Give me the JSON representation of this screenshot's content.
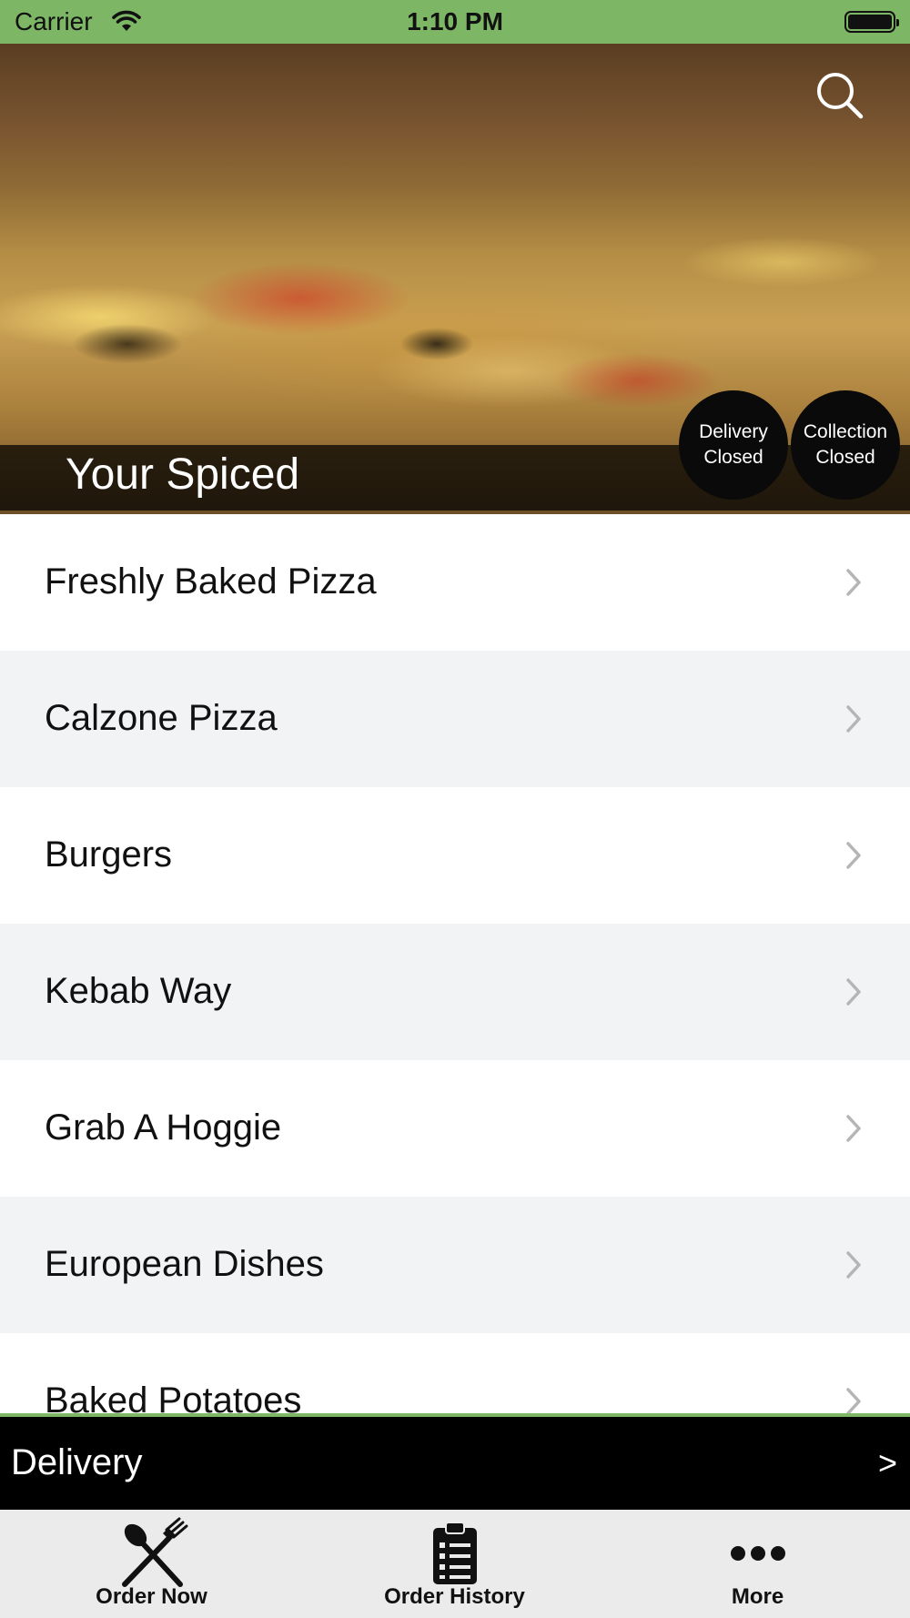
{
  "status_bar": {
    "carrier": "Carrier",
    "time": "1:10 PM",
    "wifi_icon": "wifi-icon",
    "battery_icon": "battery-icon"
  },
  "hero": {
    "title": "Your Spiced",
    "search_icon": "search-icon",
    "badges": {
      "delivery": {
        "line1": "Delivery",
        "line2": "Closed"
      },
      "collection": {
        "line1": "Collection",
        "line2": "Closed"
      }
    }
  },
  "menu": {
    "items": [
      {
        "label": "Freshly Baked Pizza"
      },
      {
        "label": "Calzone Pizza"
      },
      {
        "label": "Burgers"
      },
      {
        "label": "Kebab Way"
      },
      {
        "label": "Grab A Hoggie"
      },
      {
        "label": "European Dishes"
      },
      {
        "label": "Baked Potatoes"
      }
    ]
  },
  "delivery_bar": {
    "label": "Delivery",
    "arrow": ">"
  },
  "tabs": {
    "order_now": {
      "label": "Order Now",
      "icon": "fork-knife-icon"
    },
    "order_history": {
      "label": "Order History",
      "icon": "clipboard-list-icon"
    },
    "more": {
      "label": "More",
      "icon": "more-dots-icon"
    }
  },
  "colors": {
    "accent_green": "#7db766",
    "row_alt": "#f2f3f5",
    "badge_bg": "#0a0a0a",
    "delivery_bar_bg": "#000000",
    "tab_bar_bg": "#ebebeb"
  }
}
